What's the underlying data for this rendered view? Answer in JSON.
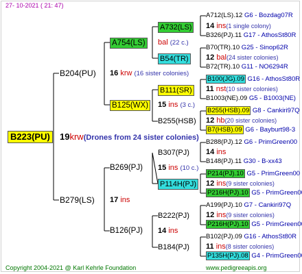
{
  "header": {
    "date": "27- 10-2021 ( 21: 47)"
  },
  "footer": {
    "copyright": "Copyright 2004-2021 @ Karl Kehrle Foundation",
    "site": "www.pedigreeapis.org"
  },
  "colors": {
    "green": "#33cc33",
    "cyan": "#33dddd",
    "yellow": "#ffff00",
    "red_text": "#cc0000",
    "blue_text": "#3333aa"
  },
  "root": {
    "name": "B223(PU)",
    "count": "19",
    "type": "krw",
    "desc": "(Drones from 24 sister colonies)"
  },
  "dam": {
    "name": "B204(PU)",
    "count": "16",
    "type": "krw",
    "desc": "(16 sister colonies)"
  },
  "sire": {
    "name": "B279(LS)",
    "count": "17",
    "type": "ins",
    "desc": ""
  },
  "dam_dam": {
    "name": "A754(LS)",
    "count": "",
    "type": "",
    "desc": ""
  },
  "dam_sire": {
    "name": "B125(WX)",
    "count": "15",
    "type": "ins",
    "desc": "(3 c.)"
  },
  "sire_dam": {
    "name": "B269(PJ)",
    "count": "15",
    "type": "ins",
    "desc": "(10 c.)"
  },
  "sire_sire": {
    "name": "B126(PJ)",
    "count": "14",
    "type": "ins",
    "desc": ""
  },
  "g3": [
    {
      "name": "A732(LS)",
      "count": "14",
      "type": "ins",
      "desc": "(1 single colony)"
    },
    {
      "name": "B54(TR)",
      "count": "12",
      "type": "bal",
      "desc": "(24 sister colonies)"
    },
    {
      "name": "B111(SR)",
      "count": "11",
      "type": "nst",
      "desc": "(10 sister colonies)"
    },
    {
      "name": "B255(HSB)",
      "count": "12",
      "type": "hb",
      "desc": "(20 sister colonies)"
    },
    {
      "name": "B307(PJ)",
      "count": "14",
      "type": "ins",
      "desc": ""
    },
    {
      "name": "P114H(PJ)",
      "count": "12",
      "type": "ins",
      "desc": "(9 sister colonies)"
    },
    {
      "name": "B222(PJ)",
      "count": "12",
      "type": "ins",
      "desc": "(9 sister colonies)"
    },
    {
      "name": "B184(PJ)",
      "count": "11",
      "type": "ins",
      "desc": "(8 sister colonies)"
    }
  ],
  "g2_extra": {
    "a754_count": "",
    "a754_type": "bal",
    "a754_desc": "(22 c.)"
  },
  "g4": [
    {
      "name": "A712(LS).12",
      "ref": "G6 - Bozdag07R"
    },
    {
      "name": "B326(PJ).11",
      "ref": "G17 - AthosSt80R"
    },
    {
      "name": "B70(TR).10",
      "ref": "G25 - Sinop62R"
    },
    {
      "name": "B72(TR).10",
      "ref": "G11 - NO6294R"
    },
    {
      "name": "B100(JG).09",
      "ref": "G16 - AthosSt80R"
    },
    {
      "name": "B1003(NE).09",
      "ref": "G5 - B1003(NE)"
    },
    {
      "name": "B255(HSB).09",
      "ref": "G8 - Cankiri97Q"
    },
    {
      "name": "B7(HSB).09",
      "ref": "G6 - Bayburt98-3"
    },
    {
      "name": "B288(PJ).12",
      "ref": "G6 - PrimGreen00"
    },
    {
      "name": "B148(PJ).11",
      "ref": "G30 - B-xx43"
    },
    {
      "name": "P214(PJ).10",
      "ref": "G5 - PrimGreen00"
    },
    {
      "name": "P216H(PJ).10",
      "ref": "G5 - PrimGreen00"
    },
    {
      "name": "A199(PJ).10",
      "ref": "G7 - Cankiri97Q"
    },
    {
      "name": "P216H(PJ).10",
      "ref": "G5 - PrimGreen00"
    },
    {
      "name": "B102(PJ).09",
      "ref": "G16 - AthosSt80R"
    },
    {
      "name": "P135H(PJ).08",
      "ref": "G4 - PrimGreen00"
    }
  ]
}
